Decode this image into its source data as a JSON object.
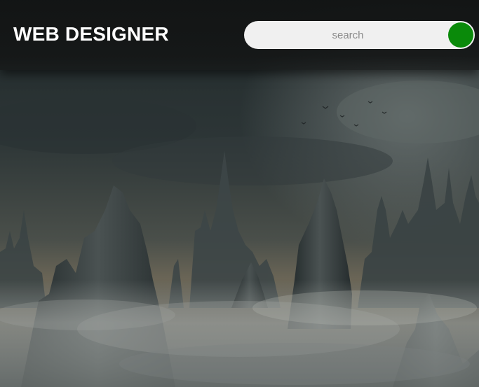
{
  "header": {
    "brand": "WEB DESIGNER"
  },
  "search": {
    "placeholder": "search",
    "value": "",
    "button_color": "#0a8a0a",
    "button_icon": "search-submit-icon"
  },
  "background": {
    "description_icon": "fantasy-mountain-castle-scene"
  },
  "colors": {
    "header_bg": "#141616",
    "brand_text": "#ffffff",
    "search_bg": "#f0f0f0",
    "accent": "#0a8a0a"
  }
}
